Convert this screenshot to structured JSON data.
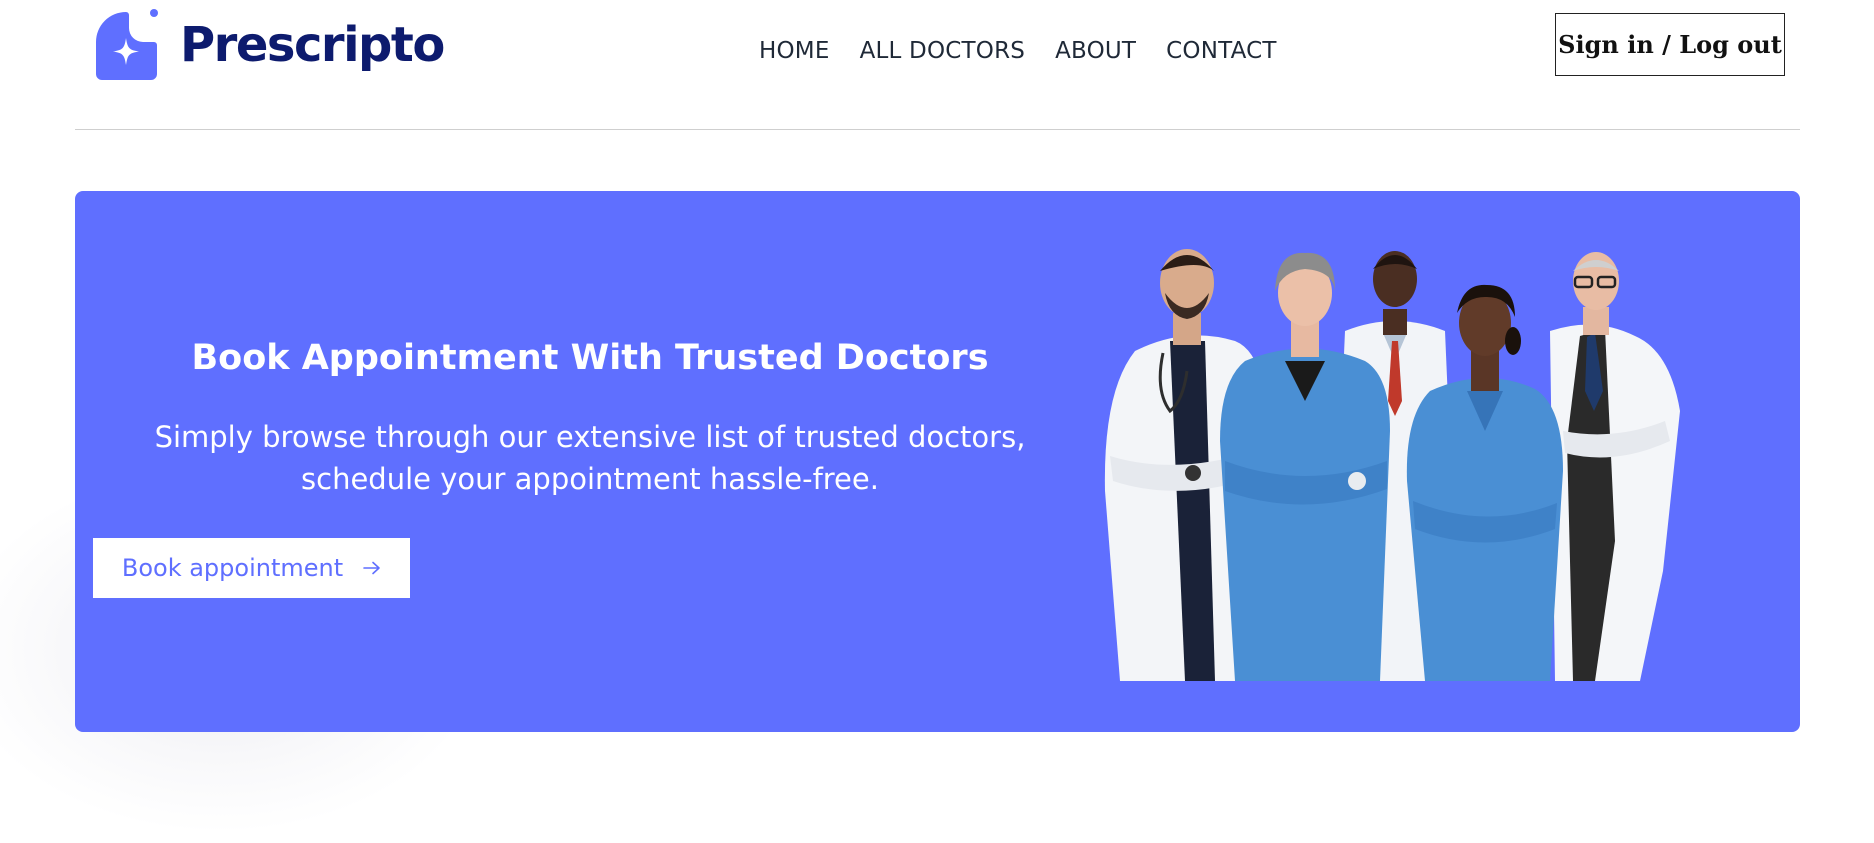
{
  "header": {
    "logo_text": "Prescripto",
    "nav": [
      {
        "label": "HOME"
      },
      {
        "label": "ALL DOCTORS"
      },
      {
        "label": "ABOUT"
      },
      {
        "label": "CONTACT"
      }
    ],
    "signin_label": "Sign in / Log out"
  },
  "hero": {
    "title": "Book Appointment With Trusted Doctors",
    "subtitle": "Simply browse through our extensive list of trusted doctors, schedule your appointment hassle-free.",
    "button_label": "Book appointment",
    "button_icon": "arrow-right-icon",
    "image": "group-of-doctors-photo"
  },
  "colors": {
    "brand": "#5f6fff",
    "logo_text": "#0d1b6e",
    "nav_text": "#1f2937",
    "divider": "#cfcfcf"
  }
}
